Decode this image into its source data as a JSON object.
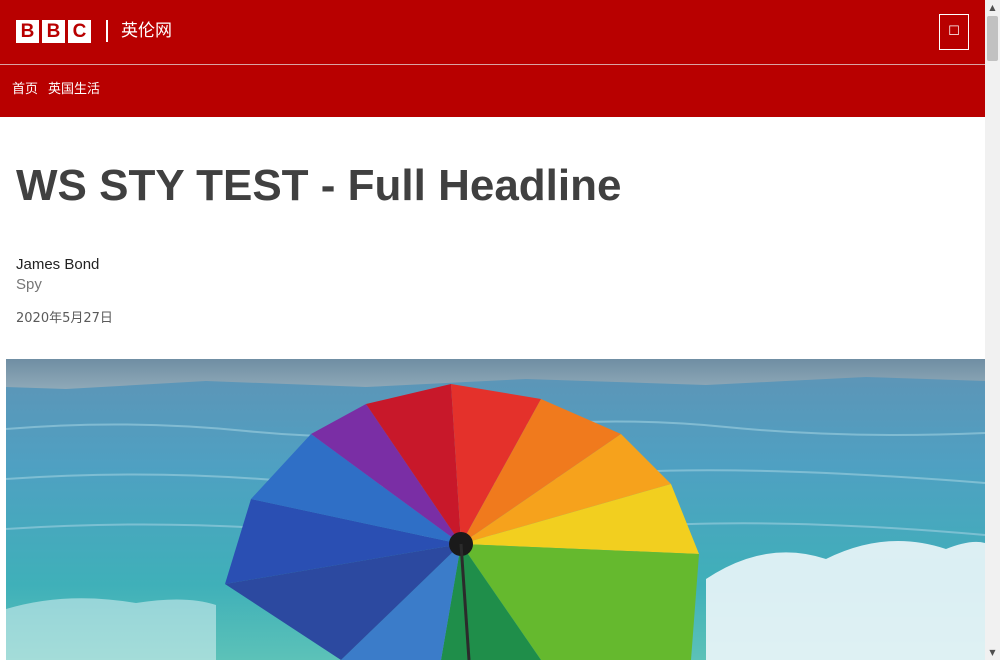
{
  "header": {
    "logo_letters": [
      "B",
      "B",
      "C"
    ],
    "brand_name": "英伦网",
    "menu_icon": "menu-icon",
    "background_color": "#b80000"
  },
  "nav": {
    "items": [
      {
        "label": "首页"
      },
      {
        "label": "英国生活"
      }
    ]
  },
  "article": {
    "headline": "WS STY TEST - Full Headline",
    "author_name": "James Bond",
    "author_role": "Spy",
    "date": "2020年5月27日",
    "image_alt": "rainbow-umbrella-beach-photo"
  },
  "scrollbar": {
    "up_icon": "▲",
    "down_icon": "▼"
  }
}
